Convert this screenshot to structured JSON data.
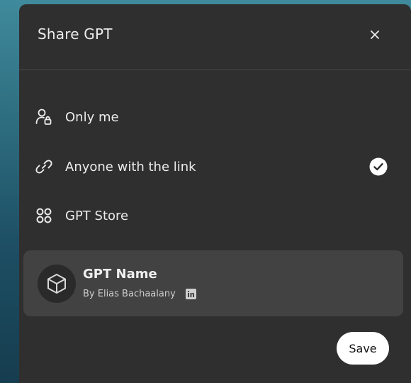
{
  "dialog": {
    "title": "Share GPT",
    "close_icon": "close-icon"
  },
  "options": [
    {
      "label": "Only me",
      "icon": "user-lock-icon",
      "selected": false
    },
    {
      "label": "Anyone with the link",
      "icon": "link-icon",
      "selected": true
    },
    {
      "label": "GPT Store",
      "icon": "grid-circles-icon",
      "selected": false
    }
  ],
  "gpt_card": {
    "name": "GPT Name",
    "author": "By Elias Bachaalany",
    "avatar_icon": "cube-icon",
    "social_icon": "linkedin-icon"
  },
  "footer": {
    "save_label": "Save"
  },
  "colors": {
    "modal_bg": "#2f2f2f",
    "card_bg": "#424242",
    "text": "#ececec",
    "save_bg": "#ffffff"
  }
}
